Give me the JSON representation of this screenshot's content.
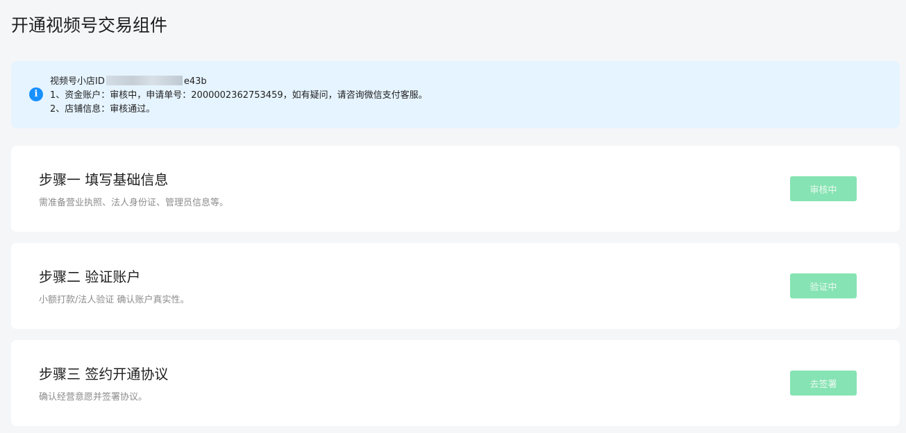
{
  "page": {
    "title": "开通视频号交易组件"
  },
  "notice": {
    "icon": "info-icon",
    "shop_id_prefix": "视频号小店ID",
    "shop_id_suffix": "e43b",
    "line1": "1、资金账户：审核中，申请单号：2000002362753459，如有疑问，请咨询微信支付客服。",
    "line2": "2、店铺信息：审核通过。"
  },
  "steps": [
    {
      "title": "步骤一 填写基础信息",
      "description": "需准备营业执照、法人身份证、管理员信息等。",
      "button": "审核中"
    },
    {
      "title": "步骤二 验证账户",
      "description": "小额打款/法人验证 确认账户真实性。",
      "button": "验证中"
    },
    {
      "title": "步骤三 签约开通协议",
      "description": "确认经营意愿并签署协议。",
      "button": "去签署"
    }
  ],
  "colors": {
    "background": "#f5f6f8",
    "notice_bg": "#e6f4ff",
    "info_blue": "#1890ff",
    "button_disabled_green": "#86e3b3",
    "text_secondary": "#8c8c8c"
  }
}
